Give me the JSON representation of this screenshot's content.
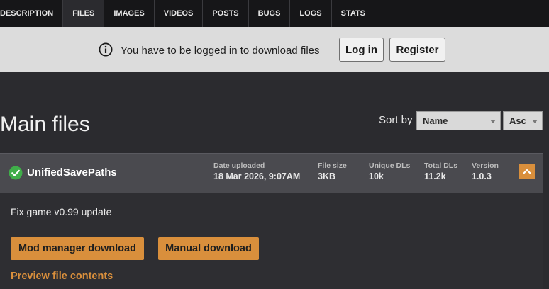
{
  "tabs": [
    {
      "label": "DESCRIPTION",
      "active": false
    },
    {
      "label": "FILES",
      "active": true
    },
    {
      "label": "IMAGES",
      "active": false
    },
    {
      "label": "VIDEOS",
      "active": false
    },
    {
      "label": "POSTS",
      "active": false
    },
    {
      "label": "BUGS",
      "active": false
    },
    {
      "label": "LOGS",
      "active": false
    },
    {
      "label": "STATS",
      "active": false
    }
  ],
  "banner": {
    "icon": "info-icon",
    "message": "You have to be logged in to download files",
    "login_label": "Log in",
    "register_label": "Register"
  },
  "main": {
    "title": "Main files",
    "sort_label": "Sort by",
    "sort_field": "Name",
    "sort_direction": "Asc"
  },
  "file": {
    "status_icon": "check-circle-icon",
    "name": "UnifiedSavePaths",
    "stats": {
      "date_label": "Date uploaded",
      "date_value": "18 Mar 2026, 9:07AM",
      "size_label": "File size",
      "size_value": "3KB",
      "unique_label": "Unique DLs",
      "unique_value": "10k",
      "total_label": "Total DLs",
      "total_value": "11.2k",
      "version_label": "Version",
      "version_value": "1.0.3"
    },
    "description": "Fix game v0.99 update",
    "mod_manager_label": "Mod manager download",
    "manual_label": "Manual download",
    "preview_label": "Preview file contents"
  },
  "colors": {
    "accent": "#d98f3c",
    "success": "#3fae49",
    "background": "#2b2b2f",
    "banner": "#dcdcdc"
  }
}
